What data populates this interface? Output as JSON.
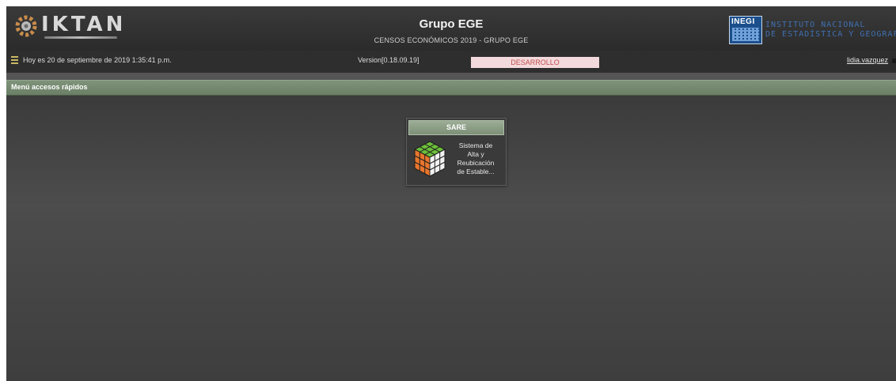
{
  "header": {
    "logo_text": "IKTAN",
    "title": "Grupo EGE",
    "subtitle": "CENSOS ECONÓMICOS 2019 - GRUPO EGE",
    "inegi_logo": "INEGI",
    "inegi_name_line1": "INSTITUTO NACIONAL",
    "inegi_name_line2": "DE ESTADÍSTICA Y GEOGRAFÍA"
  },
  "statusbar": {
    "date_text": "Hoy es 20 de septiembre de 2019 1:35:41 p.m.",
    "version": "Version[0.18.09.19]",
    "environment": "DESARROLLO",
    "user": "lidia.vazquez"
  },
  "menu": {
    "title": "Menú accesos rápidos"
  },
  "tiles": [
    {
      "title": "SARE",
      "desc_line1": "Sistema de",
      "desc_line2": "Alta y",
      "desc_line3": "Reubicación",
      "desc_line4": "de Estable...",
      "icon": "rubiks-cube-icon"
    }
  ],
  "colors": {
    "background": "#4a4a4a",
    "menubar": "#6a7f65",
    "env_badge_bg": "#f3d9dc",
    "env_badge_text": "#c0504d",
    "inegi_blue": "#1b4f8c",
    "iktan_accent": "#e07a2e"
  }
}
